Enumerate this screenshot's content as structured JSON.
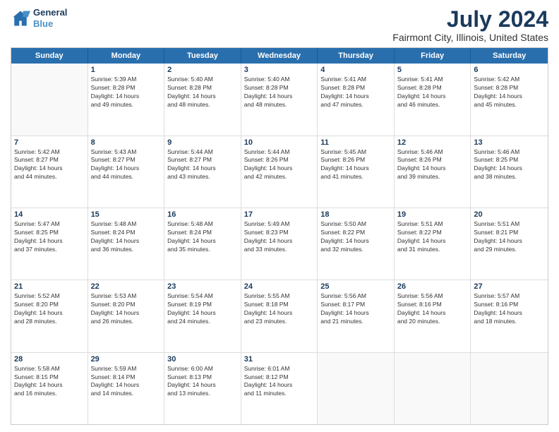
{
  "logo": {
    "line1": "General",
    "line2": "Blue"
  },
  "title": "July 2024",
  "subtitle": "Fairmont City, Illinois, United States",
  "days_of_week": [
    "Sunday",
    "Monday",
    "Tuesday",
    "Wednesday",
    "Thursday",
    "Friday",
    "Saturday"
  ],
  "weeks": [
    [
      {
        "day": "",
        "info": ""
      },
      {
        "day": "1",
        "info": "Sunrise: 5:39 AM\nSunset: 8:28 PM\nDaylight: 14 hours\nand 49 minutes."
      },
      {
        "day": "2",
        "info": "Sunrise: 5:40 AM\nSunset: 8:28 PM\nDaylight: 14 hours\nand 48 minutes."
      },
      {
        "day": "3",
        "info": "Sunrise: 5:40 AM\nSunset: 8:28 PM\nDaylight: 14 hours\nand 48 minutes."
      },
      {
        "day": "4",
        "info": "Sunrise: 5:41 AM\nSunset: 8:28 PM\nDaylight: 14 hours\nand 47 minutes."
      },
      {
        "day": "5",
        "info": "Sunrise: 5:41 AM\nSunset: 8:28 PM\nDaylight: 14 hours\nand 46 minutes."
      },
      {
        "day": "6",
        "info": "Sunrise: 5:42 AM\nSunset: 8:28 PM\nDaylight: 14 hours\nand 45 minutes."
      }
    ],
    [
      {
        "day": "7",
        "info": "Sunrise: 5:42 AM\nSunset: 8:27 PM\nDaylight: 14 hours\nand 44 minutes."
      },
      {
        "day": "8",
        "info": "Sunrise: 5:43 AM\nSunset: 8:27 PM\nDaylight: 14 hours\nand 44 minutes."
      },
      {
        "day": "9",
        "info": "Sunrise: 5:44 AM\nSunset: 8:27 PM\nDaylight: 14 hours\nand 43 minutes."
      },
      {
        "day": "10",
        "info": "Sunrise: 5:44 AM\nSunset: 8:26 PM\nDaylight: 14 hours\nand 42 minutes."
      },
      {
        "day": "11",
        "info": "Sunrise: 5:45 AM\nSunset: 8:26 PM\nDaylight: 14 hours\nand 41 minutes."
      },
      {
        "day": "12",
        "info": "Sunrise: 5:46 AM\nSunset: 8:26 PM\nDaylight: 14 hours\nand 39 minutes."
      },
      {
        "day": "13",
        "info": "Sunrise: 5:46 AM\nSunset: 8:25 PM\nDaylight: 14 hours\nand 38 minutes."
      }
    ],
    [
      {
        "day": "14",
        "info": "Sunrise: 5:47 AM\nSunset: 8:25 PM\nDaylight: 14 hours\nand 37 minutes."
      },
      {
        "day": "15",
        "info": "Sunrise: 5:48 AM\nSunset: 8:24 PM\nDaylight: 14 hours\nand 36 minutes."
      },
      {
        "day": "16",
        "info": "Sunrise: 5:48 AM\nSunset: 8:24 PM\nDaylight: 14 hours\nand 35 minutes."
      },
      {
        "day": "17",
        "info": "Sunrise: 5:49 AM\nSunset: 8:23 PM\nDaylight: 14 hours\nand 33 minutes."
      },
      {
        "day": "18",
        "info": "Sunrise: 5:50 AM\nSunset: 8:22 PM\nDaylight: 14 hours\nand 32 minutes."
      },
      {
        "day": "19",
        "info": "Sunrise: 5:51 AM\nSunset: 8:22 PM\nDaylight: 14 hours\nand 31 minutes."
      },
      {
        "day": "20",
        "info": "Sunrise: 5:51 AM\nSunset: 8:21 PM\nDaylight: 14 hours\nand 29 minutes."
      }
    ],
    [
      {
        "day": "21",
        "info": "Sunrise: 5:52 AM\nSunset: 8:20 PM\nDaylight: 14 hours\nand 28 minutes."
      },
      {
        "day": "22",
        "info": "Sunrise: 5:53 AM\nSunset: 8:20 PM\nDaylight: 14 hours\nand 26 minutes."
      },
      {
        "day": "23",
        "info": "Sunrise: 5:54 AM\nSunset: 8:19 PM\nDaylight: 14 hours\nand 24 minutes."
      },
      {
        "day": "24",
        "info": "Sunrise: 5:55 AM\nSunset: 8:18 PM\nDaylight: 14 hours\nand 23 minutes."
      },
      {
        "day": "25",
        "info": "Sunrise: 5:56 AM\nSunset: 8:17 PM\nDaylight: 14 hours\nand 21 minutes."
      },
      {
        "day": "26",
        "info": "Sunrise: 5:56 AM\nSunset: 8:16 PM\nDaylight: 14 hours\nand 20 minutes."
      },
      {
        "day": "27",
        "info": "Sunrise: 5:57 AM\nSunset: 8:16 PM\nDaylight: 14 hours\nand 18 minutes."
      }
    ],
    [
      {
        "day": "28",
        "info": "Sunrise: 5:58 AM\nSunset: 8:15 PM\nDaylight: 14 hours\nand 16 minutes."
      },
      {
        "day": "29",
        "info": "Sunrise: 5:59 AM\nSunset: 8:14 PM\nDaylight: 14 hours\nand 14 minutes."
      },
      {
        "day": "30",
        "info": "Sunrise: 6:00 AM\nSunset: 8:13 PM\nDaylight: 14 hours\nand 13 minutes."
      },
      {
        "day": "31",
        "info": "Sunrise: 6:01 AM\nSunset: 8:12 PM\nDaylight: 14 hours\nand 11 minutes."
      },
      {
        "day": "",
        "info": ""
      },
      {
        "day": "",
        "info": ""
      },
      {
        "day": "",
        "info": ""
      }
    ]
  ]
}
